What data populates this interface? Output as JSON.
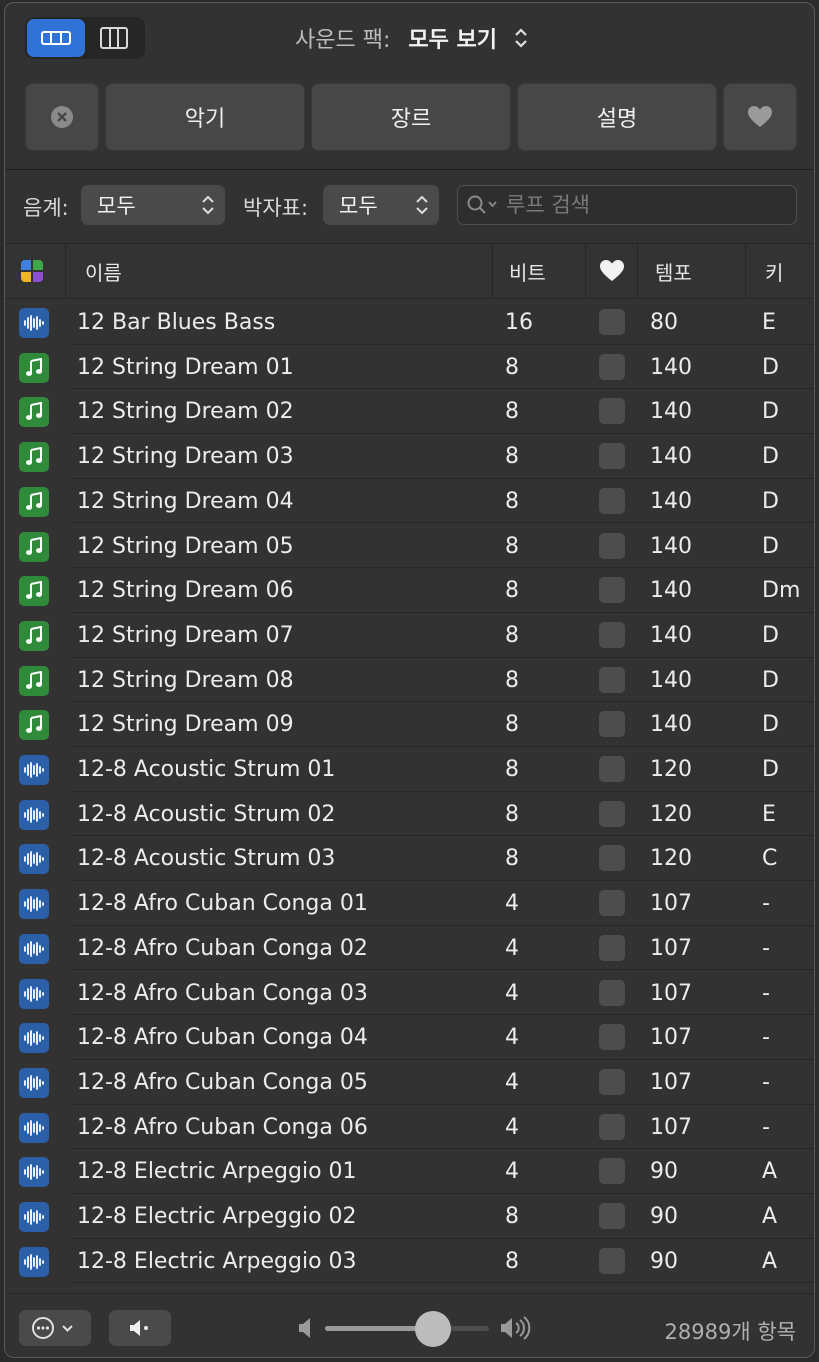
{
  "header": {
    "soundpack_label": "사운드 팩:",
    "soundpack_value": "모두 보기"
  },
  "filters": {
    "instrument": "악기",
    "genre": "장르",
    "description": "설명"
  },
  "scale": {
    "label": "음계:",
    "value": "모두"
  },
  "meter": {
    "label": "박자표:",
    "value": "모두"
  },
  "search": {
    "placeholder": "루프 검색"
  },
  "columns": {
    "name": "이름",
    "beats": "비트",
    "tempo": "템포",
    "key": "키"
  },
  "rows": [
    {
      "type": "audio",
      "name": "12 Bar Blues Bass",
      "beats": "16",
      "tempo": "80",
      "key": "E"
    },
    {
      "type": "midi",
      "name": "12 String Dream 01",
      "beats": "8",
      "tempo": "140",
      "key": "D"
    },
    {
      "type": "midi",
      "name": "12 String Dream 02",
      "beats": "8",
      "tempo": "140",
      "key": "D"
    },
    {
      "type": "midi",
      "name": "12 String Dream 03",
      "beats": "8",
      "tempo": "140",
      "key": "D"
    },
    {
      "type": "midi",
      "name": "12 String Dream 04",
      "beats": "8",
      "tempo": "140",
      "key": "D"
    },
    {
      "type": "midi",
      "name": "12 String Dream 05",
      "beats": "8",
      "tempo": "140",
      "key": "D"
    },
    {
      "type": "midi",
      "name": "12 String Dream 06",
      "beats": "8",
      "tempo": "140",
      "key": "Dm"
    },
    {
      "type": "midi",
      "name": "12 String Dream 07",
      "beats": "8",
      "tempo": "140",
      "key": "D"
    },
    {
      "type": "midi",
      "name": "12 String Dream 08",
      "beats": "8",
      "tempo": "140",
      "key": "D"
    },
    {
      "type": "midi",
      "name": "12 String Dream 09",
      "beats": "8",
      "tempo": "140",
      "key": "D"
    },
    {
      "type": "audio",
      "name": "12-8 Acoustic Strum 01",
      "beats": "8",
      "tempo": "120",
      "key": "D"
    },
    {
      "type": "audio",
      "name": "12-8 Acoustic Strum 02",
      "beats": "8",
      "tempo": "120",
      "key": "E"
    },
    {
      "type": "audio",
      "name": "12-8 Acoustic Strum 03",
      "beats": "8",
      "tempo": "120",
      "key": "C"
    },
    {
      "type": "audio",
      "name": "12-8 Afro Cuban Conga 01",
      "beats": "4",
      "tempo": "107",
      "key": "-"
    },
    {
      "type": "audio",
      "name": "12-8 Afro Cuban Conga 02",
      "beats": "4",
      "tempo": "107",
      "key": "-"
    },
    {
      "type": "audio",
      "name": "12-8 Afro Cuban Conga 03",
      "beats": "4",
      "tempo": "107",
      "key": "-"
    },
    {
      "type": "audio",
      "name": "12-8 Afro Cuban Conga 04",
      "beats": "4",
      "tempo": "107",
      "key": "-"
    },
    {
      "type": "audio",
      "name": "12-8 Afro Cuban Conga 05",
      "beats": "4",
      "tempo": "107",
      "key": "-"
    },
    {
      "type": "audio",
      "name": "12-8 Afro Cuban Conga 06",
      "beats": "4",
      "tempo": "107",
      "key": "-"
    },
    {
      "type": "audio",
      "name": "12-8 Electric Arpeggio 01",
      "beats": "4",
      "tempo": "90",
      "key": "A"
    },
    {
      "type": "audio",
      "name": "12-8 Electric Arpeggio 02",
      "beats": "8",
      "tempo": "90",
      "key": "A"
    },
    {
      "type": "audio",
      "name": "12-8 Electric Arpeggio 03",
      "beats": "8",
      "tempo": "90",
      "key": "A"
    }
  ],
  "footer": {
    "volume_level": 0.66,
    "count": "28989개 항목"
  },
  "colors": {
    "accent": "#2f73d8",
    "audio_icon": "#2b5fa8",
    "midi_icon": "#2f8a3a"
  },
  "icons": {
    "audio": "waveform-icon",
    "midi": "music-note-icon",
    "favorite": "heart-icon",
    "clear": "close-circle-icon"
  }
}
